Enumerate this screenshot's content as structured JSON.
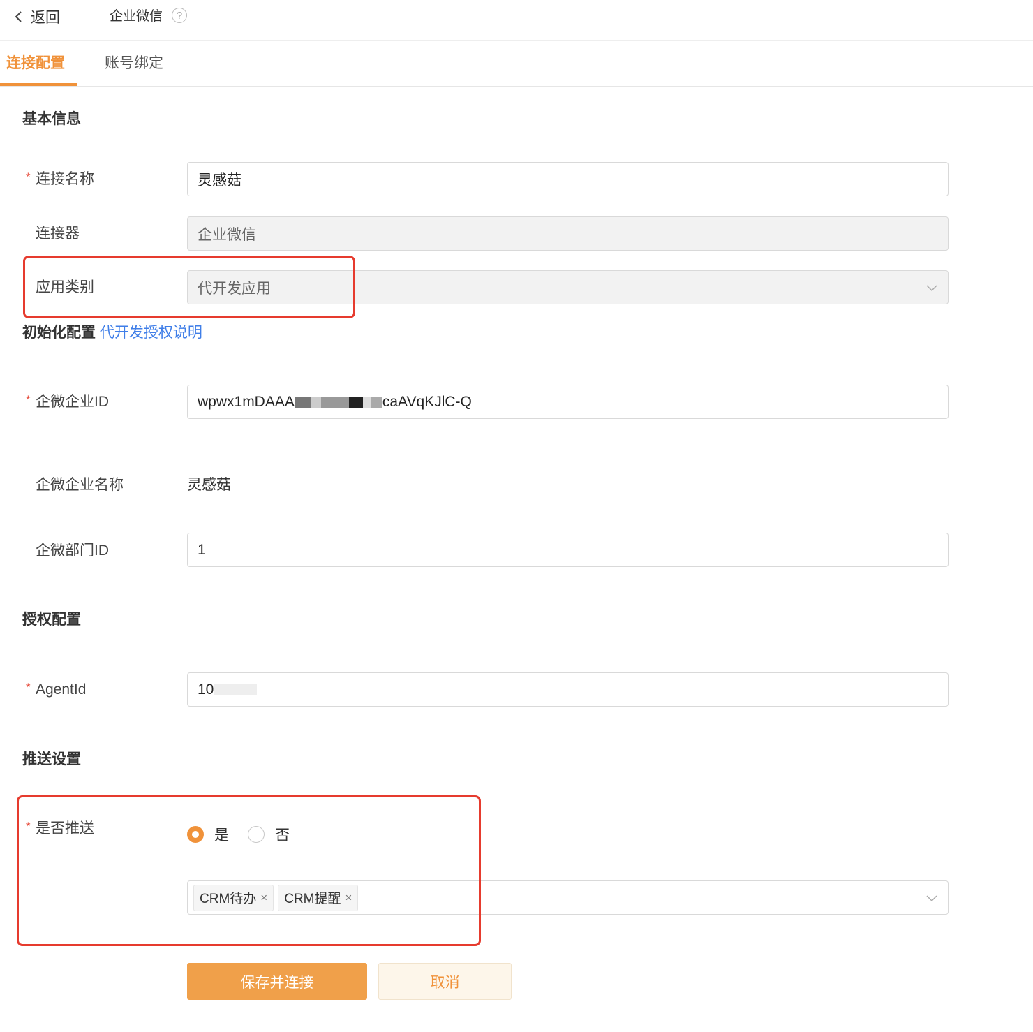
{
  "header": {
    "back_label": "返回",
    "title": "企业微信",
    "help_symbol": "?"
  },
  "tabs": [
    {
      "label": "连接配置",
      "active": true
    },
    {
      "label": "账号绑定",
      "active": false
    }
  ],
  "sections": {
    "basic": {
      "title": "基本信息",
      "connection_name": {
        "label": "连接名称",
        "required": true,
        "value": "灵感菇"
      },
      "connector": {
        "label": "连接器",
        "value": "企业微信"
      },
      "app_type": {
        "label": "应用类别",
        "value": "代开发应用"
      }
    },
    "init": {
      "title": "初始化配置",
      "link": "代开发授权说明",
      "corp_id": {
        "label": "企微企业ID",
        "required": true,
        "value_prefix": "wpwx1mDAAA",
        "value_suffix": "caAVqKJlC-Q"
      },
      "corp_name": {
        "label": "企微企业名称",
        "value": "灵感菇"
      },
      "dept_id": {
        "label": "企微部门ID",
        "value": "1"
      }
    },
    "auth": {
      "title": "授权配置",
      "agent_id": {
        "label": "AgentId",
        "required": true,
        "value_prefix": "10"
      }
    },
    "push": {
      "title": "推送设置",
      "enable_push": {
        "label": "是否推送",
        "required": true,
        "options": [
          {
            "label": "是",
            "checked": true
          },
          {
            "label": "否",
            "checked": false
          }
        ]
      },
      "push_types": [
        "CRM待办",
        "CRM提醒"
      ],
      "tag_close": "×"
    }
  },
  "actions": {
    "save_label": "保存并连接",
    "cancel_label": "取消"
  },
  "colors": {
    "accent": "#f0923a",
    "link": "#3f7ee8",
    "highlight_box": "#e63b2e",
    "required": "#e74c3c"
  }
}
